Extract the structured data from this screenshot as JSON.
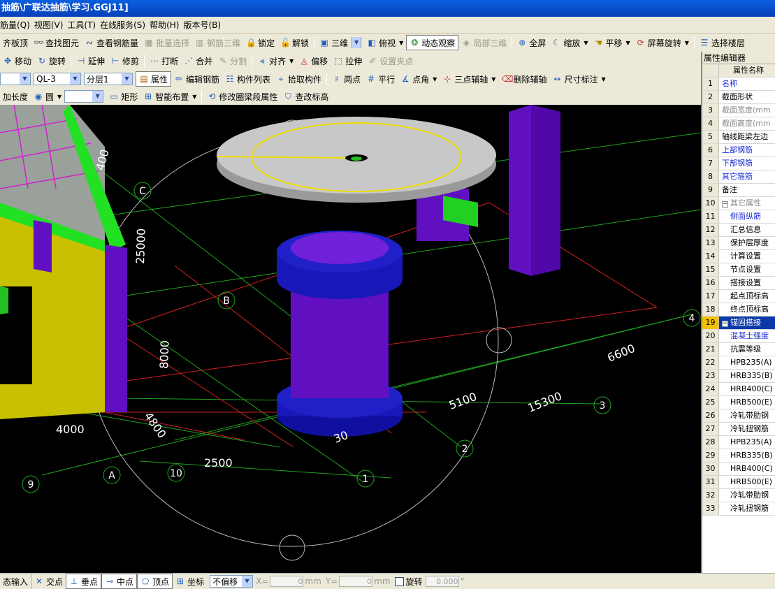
{
  "window": {
    "title": "抽筋\\广联达抽筋\\学习.GGJ11]"
  },
  "menu": [
    "筋量(Q)",
    "视图(V)",
    "工具(T)",
    "在线服务(S)",
    "帮助(H)",
    "版本号(B)"
  ],
  "toolbar1": {
    "items": [
      "齐板顶",
      "查找图元",
      "查看钢筋量",
      "批量选择",
      "钢筋三维",
      "锁定",
      "解锁",
      "三维",
      "俯视",
      "动态观察",
      "局部三维",
      "全屏",
      "缩放",
      "平移",
      "屏幕旋转",
      "选择楼层"
    ]
  },
  "toolbar2": {
    "items": [
      "移动",
      "旋转",
      "延伸",
      "修剪",
      "打断",
      "合并",
      "分割",
      "对齐",
      "偏移",
      "拉伸",
      "设置夹点"
    ]
  },
  "toolbar3": {
    "combo_empty": "",
    "component": "QL-3",
    "layer": "分层1",
    "items": [
      "属性",
      "编辑钢筋",
      "构件列表",
      "拾取构件",
      "两点",
      "平行",
      "点角",
      "三点辅轴",
      "删除辅轴",
      "尺寸标注"
    ]
  },
  "toolbar4": {
    "prefix": "加长度",
    "shape": "圆",
    "items": [
      "矩形",
      "智能布置",
      "修改圈梁段属性",
      "查改标高"
    ]
  },
  "viewport": {
    "axis_labels": [
      "C",
      "B",
      "A",
      "1",
      "2",
      "3",
      "4",
      "9",
      "10"
    ],
    "dimensions": [
      "400",
      "25000",
      "8000",
      "4000",
      "4800",
      "2500",
      "5100",
      "15300",
      "6600",
      "30"
    ]
  },
  "property_panel": {
    "title": "属性编辑器",
    "header": "属性名称",
    "rows": [
      {
        "n": "1",
        "name": "名称",
        "style": "blue"
      },
      {
        "n": "2",
        "name": "截面形状",
        "style": ""
      },
      {
        "n": "3",
        "name": "截面宽度(mm",
        "style": "grey"
      },
      {
        "n": "4",
        "name": "截面高度(mm",
        "style": "grey"
      },
      {
        "n": "5",
        "name": "轴线距梁左边",
        "style": ""
      },
      {
        "n": "6",
        "name": "上部钢筋",
        "style": "blue"
      },
      {
        "n": "7",
        "name": "下部钢筋",
        "style": "blue"
      },
      {
        "n": "8",
        "name": "其它箍筋",
        "style": "blue"
      },
      {
        "n": "9",
        "name": "备注",
        "style": ""
      },
      {
        "n": "10",
        "name": "其它属性",
        "style": "grey",
        "tree": "−"
      },
      {
        "n": "11",
        "name": "侧面纵筋",
        "style": "blue",
        "indent": true
      },
      {
        "n": "12",
        "name": "汇总信息",
        "style": "",
        "indent": true
      },
      {
        "n": "13",
        "name": "保护层厚度",
        "style": "",
        "indent": true
      },
      {
        "n": "14",
        "name": "计算设置",
        "style": "",
        "indent": true
      },
      {
        "n": "15",
        "name": "节点设置",
        "style": "",
        "indent": true
      },
      {
        "n": "16",
        "name": "搭接设置",
        "style": "",
        "indent": true
      },
      {
        "n": "17",
        "name": "起点顶标高",
        "style": "",
        "indent": true
      },
      {
        "n": "18",
        "name": "终点顶标高",
        "style": "",
        "indent": true
      },
      {
        "n": "19",
        "name": "锚固搭接",
        "style": "",
        "tree": "−",
        "selected": true
      },
      {
        "n": "20",
        "name": "混凝土强度",
        "style": "blue",
        "indent": true
      },
      {
        "n": "21",
        "name": "抗震等级",
        "style": "",
        "indent": true
      },
      {
        "n": "22",
        "name": "HPB235(A)",
        "style": "",
        "indent": true
      },
      {
        "n": "23",
        "name": "HRB335(B)",
        "style": "",
        "indent": true
      },
      {
        "n": "24",
        "name": "HRB400(C)",
        "style": "",
        "indent": true
      },
      {
        "n": "25",
        "name": "HRB500(E)",
        "style": "",
        "indent": true
      },
      {
        "n": "26",
        "name": "冷轧带肋钢",
        "style": "",
        "indent": true
      },
      {
        "n": "27",
        "name": "冷轧扭钢筋",
        "style": "",
        "indent": true
      },
      {
        "n": "28",
        "name": "HPB235(A)",
        "style": "",
        "indent": true
      },
      {
        "n": "29",
        "name": "HRB335(B)",
        "style": "",
        "indent": true
      },
      {
        "n": "30",
        "name": "HRB400(C)",
        "style": "",
        "indent": true
      },
      {
        "n": "31",
        "name": "HRB500(E)",
        "style": "",
        "indent": true
      },
      {
        "n": "32",
        "name": "冷轧带肋钢",
        "style": "",
        "indent": true
      },
      {
        "n": "33",
        "name": "冷轧扭钢筋",
        "style": "",
        "indent": true
      }
    ]
  },
  "statusbar": {
    "mode": "态输入",
    "snaps": [
      "交点",
      "垂点",
      "中点",
      "顶点",
      "坐标"
    ],
    "offset_mode": "不偏移",
    "x_label": "X=",
    "x_value": "0",
    "y_label": "Y=",
    "y_value": "0",
    "unit": "mm",
    "rotate_label": "旋转",
    "rotate_value": "0.000",
    "degree": "°"
  }
}
